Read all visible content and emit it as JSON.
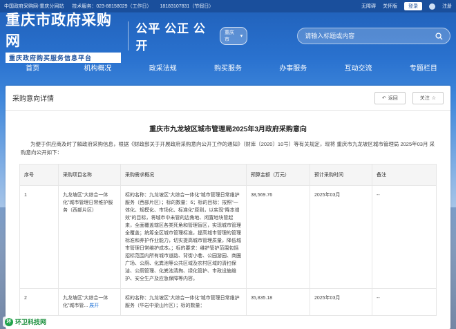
{
  "topbar": {
    "site_name": "中国政府采购网-重庆分网站",
    "tech_service_label": "技术服务：023-88158029（工作日）",
    "holiday_service_label": "18183107831（节假日）",
    "accessibility": "无障碍",
    "elder_mode": "关怀版",
    "login": "登录",
    "register": "注册"
  },
  "header": {
    "title": "重庆市政府采购网",
    "subtitle": "重庆政府购买服务信息平台",
    "slogan": "公平 公正 公开",
    "region": "重庆市",
    "search_placeholder": "请输入标题或内容"
  },
  "nav": {
    "items": [
      "首页",
      "机构概况",
      "政采法规",
      "购买服务",
      "办事服务",
      "互动交流",
      "专题栏目"
    ]
  },
  "panel": {
    "title": "采购意向详情",
    "back": "返回",
    "follow": "关注",
    "doc_title": "重庆市九龙坡区城市管理局2025年3月政府采购意向",
    "intro": "为便于供应商及时了解政府采购信息，根据《财政部关于开展政府采购意向公开工作的通知》（财库〔2020〕10号）等有关规定，现将 重庆市九龙坡区城市管理局 2025年03月 采购意向公开如下："
  },
  "table": {
    "headers": [
      "序号",
      "采购项目名称",
      "采购需求概况",
      "预算金额（万元）",
      "预计采购时间",
      "备注"
    ],
    "rows": [
      {
        "no": "1",
        "name": "九龙坡区“大综合一体化”城市管理日常维护服务（西部片区）",
        "summary": "标的名称：九龙坡区“大综合一体化”城市管理日常维护服务（西部片区）；标的数量：6；标的目标：按照“一体化、规模化、市场化、标准化”原则，以实现“降本增效”的目标，将城市中未管的边角地、闲置地块管起来，全面覆盖辖区各类死角和管理盲区，实现城市管理全覆盖；统筹全区城市管理标准，提高城市管理的管理标准和养护作业能力，切实提高城市管理质量，降低城市管理日常维护成本。；标的要求：维护管护范围包括招标范围内所有城市道路、背街小巷、公园游园、商圈广场、公厕、化粪池等公共区域及农村区域的清扫保洁、公厕管理、化粪池清掏、绿化管护、市政设施维护、安全生产及应急保障等内容。",
        "budget": "38,569.76",
        "time": "2025年03月",
        "note": "--"
      },
      {
        "no": "2",
        "name": "九龙坡区“大综合一体化”城市管...",
        "expand": "展开",
        "summary": "标的名称：九龙坡区“大综合一体化”城市管理日常维护服务（华岩中梁山片区）；标的数量：",
        "budget": "35,835.18",
        "time": "2025年03月",
        "note": "--"
      }
    ]
  },
  "watermark": "环卫科技网"
}
